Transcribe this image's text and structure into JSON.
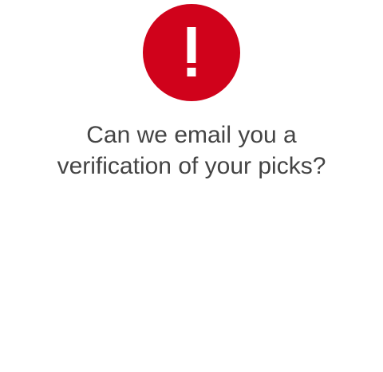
{
  "dialog": {
    "icon": "exclamation-alert-icon",
    "icon_color": "#D0021B",
    "icon_glyph_color": "#FFFFFF",
    "message_lines": [
      "Can we email you a",
      "verification of your picks?"
    ],
    "text_color": "#444444"
  }
}
